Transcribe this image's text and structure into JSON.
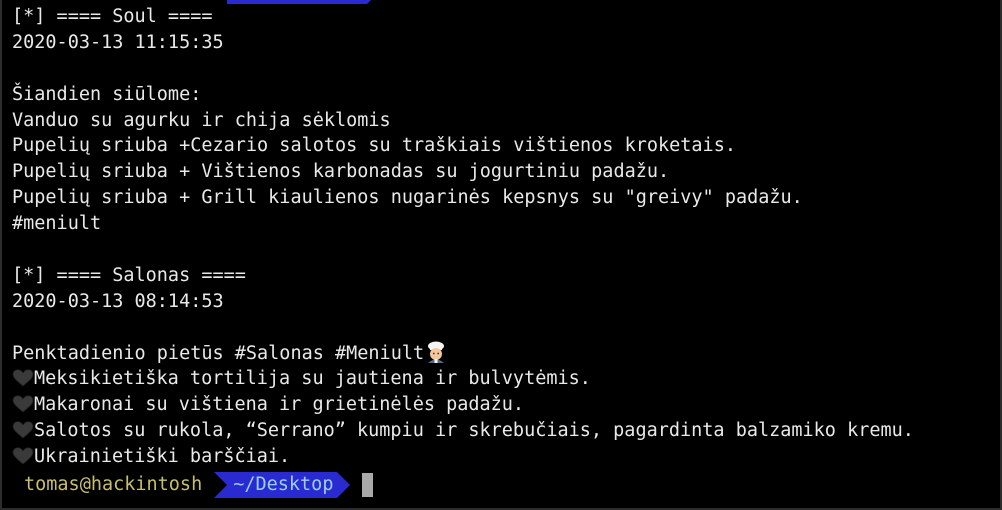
{
  "window": {
    "background": "#000000",
    "text_color": "#e9e9e9"
  },
  "output": {
    "lines": [
      "[*] ==== Soul ====",
      "2020-03-13 11:15:35",
      "",
      "Šiandien siūlome:",
      "Vanduo su agurku ir chija sėklomis",
      "Pupelių sriuba +Cezario salotos su traškiais vištienos kroketais.",
      "Pupelių sriuba + Vištienos karbonadas su jogurtiniu padažu.",
      "Pupelių sriuba + Grill kiaulienos nugarinės kepsnys su \"greivy\" padažu.",
      "#meniult",
      "",
      "[*] ==== Salonas ====",
      "2020-03-13 08:14:53",
      "",
      "Penktadienio pietūs #Salonas #Meniult",
      "Meksikietiška tortilija su jautiena ir bulvytėmis.",
      "Makaronai su vištiena ir grietinėlės padažu.",
      "Salotos su rukola, “Serrano” kumpiu ir skrebučiais, pagardinta balzamiko kremu.",
      "Ukrainietiški barščiai."
    ],
    "emoji": {
      "chef_icon": "cook-emoji",
      "heart_icon": "black-heart-emoji"
    }
  },
  "prompt": {
    "user_host": "tomas@hackintosh",
    "cwd": "~/Desktop",
    "colors": {
      "user_host": "#c8bf6a",
      "cwd_bg": "#2a2ad1",
      "cwd_text": "#9ad0ff",
      "cursor": "#a9a9a9"
    }
  }
}
